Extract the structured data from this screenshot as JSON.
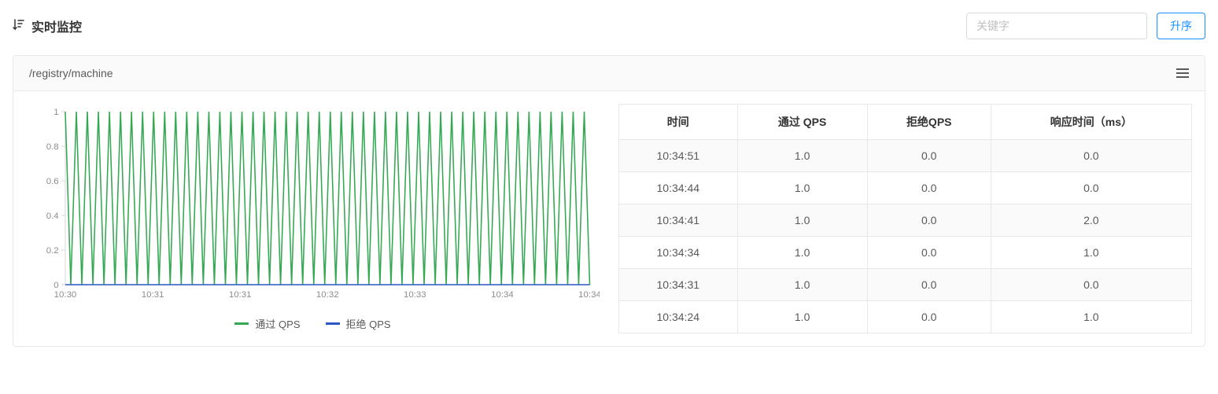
{
  "header": {
    "title": "实时监控",
    "search_placeholder": "关键字",
    "sort_button": "升序"
  },
  "card": {
    "resource": "/registry/machine"
  },
  "legend": {
    "pass_label": "通过 QPS",
    "reject_label": "拒绝 QPS"
  },
  "table": {
    "headers": {
      "time": "时间",
      "pass": "通过 QPS",
      "reject": "拒绝QPS",
      "rt": "响应时间（ms）"
    },
    "rows": [
      {
        "time": "10:34:51",
        "pass": "1.0",
        "reject": "0.0",
        "rt": "0.0"
      },
      {
        "time": "10:34:44",
        "pass": "1.0",
        "reject": "0.0",
        "rt": "0.0"
      },
      {
        "time": "10:34:41",
        "pass": "1.0",
        "reject": "0.0",
        "rt": "2.0"
      },
      {
        "time": "10:34:34",
        "pass": "1.0",
        "reject": "0.0",
        "rt": "1.0"
      },
      {
        "time": "10:34:31",
        "pass": "1.0",
        "reject": "0.0",
        "rt": "0.0"
      },
      {
        "time": "10:34:24",
        "pass": "1.0",
        "reject": "0.0",
        "rt": "1.0"
      }
    ]
  },
  "chart_data": {
    "type": "line",
    "title": "",
    "xlabel": "",
    "ylabel": "",
    "ylim": [
      0,
      1
    ],
    "y_ticks": [
      0,
      0.2,
      0.4,
      0.6,
      0.8,
      1
    ],
    "x_tick_labels": [
      "10:30",
      "10:31",
      "10:31",
      "10:32",
      "10:33",
      "10:34",
      "10:34"
    ],
    "series": [
      {
        "name": "通过 QPS",
        "color": "#34a853",
        "values": [
          1,
          0,
          1,
          0,
          1,
          0,
          1,
          0,
          1,
          0,
          1,
          0,
          1,
          0,
          1,
          0,
          1,
          0,
          1,
          0,
          1,
          0,
          1,
          0,
          1,
          0,
          1,
          0,
          1,
          0,
          1,
          0,
          1,
          0,
          1,
          0,
          1,
          0,
          1,
          0,
          1,
          0,
          1,
          0,
          1,
          0,
          1,
          0,
          1,
          0,
          1,
          0,
          1,
          0,
          1,
          0,
          1,
          0,
          1,
          0,
          1,
          0,
          1,
          0,
          1,
          0,
          1,
          0,
          1,
          0,
          1,
          0,
          1,
          0,
          1,
          0,
          1,
          0,
          1,
          0,
          1,
          0,
          1,
          0,
          1,
          0,
          1,
          0,
          1,
          0,
          1,
          0,
          1,
          0,
          1,
          0
        ]
      },
      {
        "name": "拒绝 QPS",
        "color": "#2a56c6",
        "values": [
          0,
          0,
          0,
          0,
          0,
          0,
          0,
          0,
          0,
          0,
          0,
          0,
          0,
          0,
          0,
          0,
          0,
          0,
          0,
          0,
          0,
          0,
          0,
          0,
          0,
          0,
          0,
          0,
          0,
          0,
          0,
          0,
          0,
          0,
          0,
          0,
          0,
          0,
          0,
          0,
          0,
          0,
          0,
          0,
          0,
          0,
          0,
          0,
          0,
          0,
          0,
          0,
          0,
          0,
          0,
          0,
          0,
          0,
          0,
          0,
          0,
          0,
          0,
          0,
          0,
          0,
          0,
          0,
          0,
          0,
          0,
          0,
          0,
          0,
          0,
          0,
          0,
          0,
          0,
          0,
          0,
          0,
          0,
          0,
          0,
          0,
          0,
          0,
          0,
          0,
          0,
          0,
          0,
          0,
          0,
          0
        ]
      }
    ],
    "legend_position": "bottom",
    "grid": false
  },
  "colors": {
    "pass": "#34a853",
    "reject": "#2a56c6",
    "axis": "#d9d9d9",
    "tick": "#8c8c8c"
  }
}
